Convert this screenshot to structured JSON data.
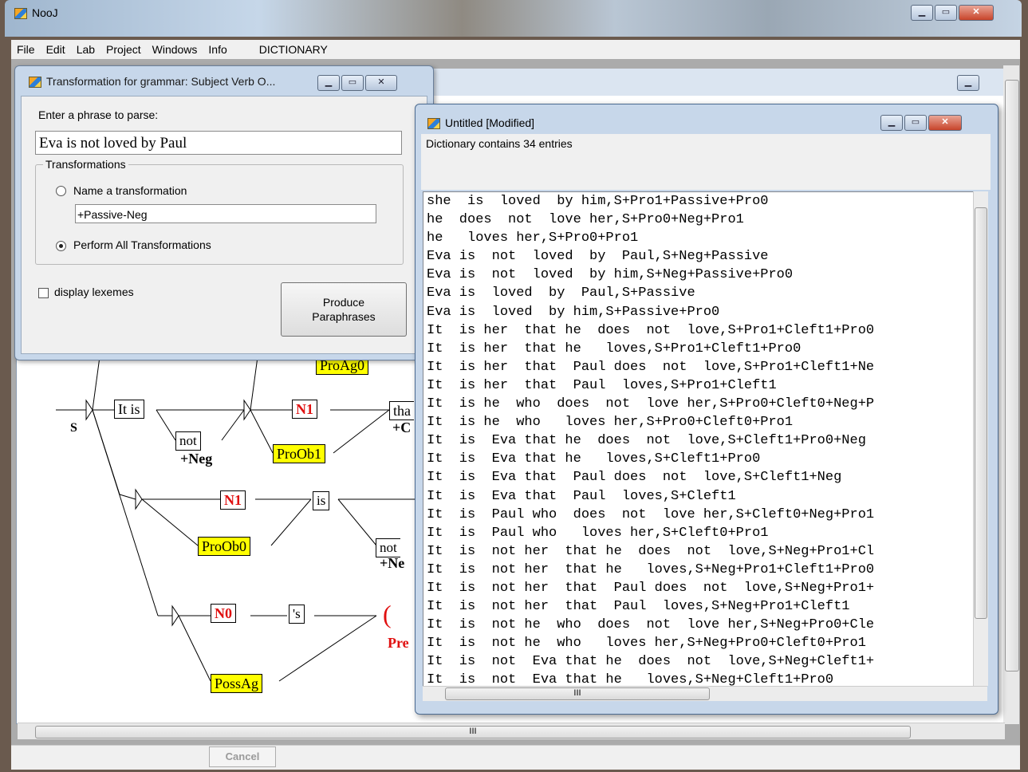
{
  "main_window": {
    "title": "NooJ",
    "menu": [
      "File",
      "Edit",
      "Lab",
      "Project",
      "Windows",
      "Info",
      "DICTIONARY"
    ],
    "cancel_label": "Cancel"
  },
  "graph": {
    "axiom": "S",
    "boxes": {
      "it_is": "It is",
      "not1": "not",
      "neg1": "+Neg",
      "n1_a": "N1",
      "proob1": "ProOb1",
      "proag0": "ProAg0",
      "that": "tha",
      "plus_c": "+C",
      "n1_b": "N1",
      "is": "is",
      "proob0": "ProOb0",
      "not2": "not",
      "neg2": "+Ne",
      "n0": "N0",
      "s_poss": "'s",
      "possag": "PossAg",
      "paren": "(",
      "pre": "Pre"
    }
  },
  "transform_window": {
    "title": "Transformation for grammar: Subject Verb O...",
    "prompt_label": "Enter a phrase to parse:",
    "phrase_value": "Eva is not loved by Paul",
    "group_label": "Transformations",
    "radio_name_label": "Name a transformation",
    "transformation_value": "+Passive-Neg",
    "radio_all_label": "Perform All Transformations",
    "display_lexemes_label": "display lexemes",
    "produce_button": "Produce\nParaphrases"
  },
  "dict_window": {
    "title": "Untitled [Modified]",
    "info": "Dictionary contains 34 entries",
    "hscroll_grip": "III",
    "lines": [
      "she  is  loved  by him,S+Pro1+Passive+Pro0",
      "he  does  not  love her,S+Pro0+Neg+Pro1",
      "he   loves her,S+Pro0+Pro1",
      "Eva is  not  loved  by  Paul,S+Neg+Passive",
      "Eva is  not  loved  by him,S+Neg+Passive+Pro0",
      "Eva is  loved  by  Paul,S+Passive",
      "Eva is  loved  by him,S+Passive+Pro0",
      "It  is her  that he  does  not  love,S+Pro1+Cleft1+Pro0",
      "It  is her  that he   loves,S+Pro1+Cleft1+Pro0",
      "It  is her  that  Paul does  not  love,S+Pro1+Cleft1+Ne",
      "It  is her  that  Paul  loves,S+Pro1+Cleft1",
      "It  is he  who  does  not  love her,S+Pro0+Cleft0+Neg+P",
      "It  is he  who   loves her,S+Pro0+Cleft0+Pro1",
      "It  is  Eva that he  does  not  love,S+Cleft1+Pro0+Neg",
      "It  is  Eva that he   loves,S+Cleft1+Pro0",
      "It  is  Eva that  Paul does  not  love,S+Cleft1+Neg",
      "It  is  Eva that  Paul  loves,S+Cleft1",
      "It  is  Paul who  does  not  love her,S+Cleft0+Neg+Pro1",
      "It  is  Paul who   loves her,S+Cleft0+Pro1",
      "It  is  not her  that he  does  not  love,S+Neg+Pro1+Cl",
      "It  is  not her  that he   loves,S+Neg+Pro1+Cleft1+Pro0",
      "It  is  not her  that  Paul does  not  love,S+Neg+Pro1+",
      "It  is  not her  that  Paul  loves,S+Neg+Pro1+Cleft1",
      "It  is  not he  who  does  not  love her,S+Neg+Pro0+Cle",
      "It  is  not he  who   loves her,S+Neg+Pro0+Cleft0+Pro1",
      "It  is  not  Eva that he  does  not  love,S+Neg+Cleft1+",
      "It  is  not  Eva that he   loves,S+Neg+Cleft1+Pro0"
    ]
  },
  "main_hscroll_grip": "III"
}
